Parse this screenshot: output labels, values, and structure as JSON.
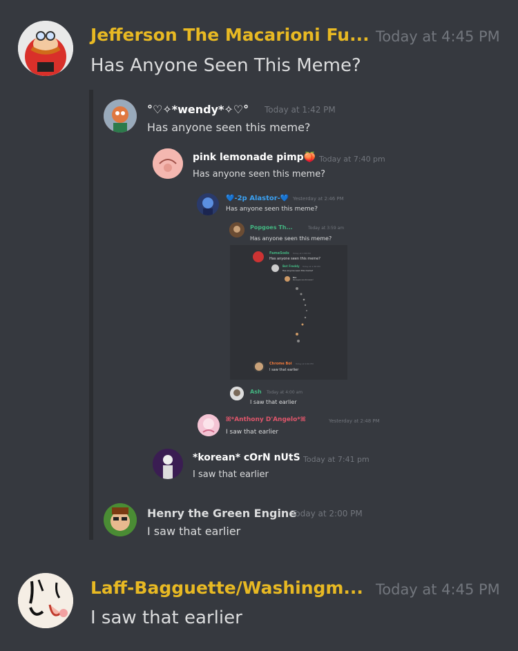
{
  "colors": {
    "background": "#36393f",
    "name_top": "#e8b923",
    "timestamp": "#72767d",
    "text": "#dcddde"
  },
  "top_message": {
    "author": "Jefferson The Macarioni Fu...",
    "timestamp": "Today at 4:45 PM",
    "text": "Has Anyone Seen This Meme?",
    "avatar_icon": "eggman-avatar"
  },
  "nested": [
    {
      "author": "°♡✧*wendy*✧♡°",
      "timestamp": "Today at 1:42 PM",
      "text": "Has anyone seen this meme?",
      "name_color": "#ffffff"
    },
    {
      "author": "pink lemonade pimp🍑",
      "timestamp": "Today at 7:40 pm",
      "text": "Has anyone seen this meme?",
      "name_color": "#ffffff"
    },
    {
      "author": "💙-2p Alastor-💙",
      "timestamp": "Yesterday at 2:46 PM",
      "text": "Has anyone seen this meme?",
      "name_color": "#3ba1f2"
    },
    {
      "author": "Popgoes Th...",
      "timestamp": "Today at 3:59 am",
      "text": "Has anyone seen this meme?",
      "name_color": "#43b581"
    },
    {
      "author": "FameSods",
      "timestamp": "Today at 1:58 PM",
      "text": "Has anyone seen this meme?",
      "name_color": "#43b581"
    },
    {
      "author": "Bot Freddy",
      "timestamp": "Today at 1:58 PM",
      "text": "Has anyone seen this meme?",
      "name_color": "#43b581"
    },
    {
      "author": "fox",
      "timestamp": "",
      "text": "Has anyone seen this meme?",
      "name_color": "#dcddde"
    },
    {
      "author": "Chrome Boi",
      "timestamp": "Today at 9:40 PM",
      "text": "I saw that earlier",
      "name_color": "#f47b3b"
    },
    {
      "author": "Ash",
      "timestamp": "Today at 4:00 am",
      "text": "I saw that earlier",
      "name_color": "#43b581"
    },
    {
      "author": "ꕤ*Anthony D'Angelo*ꕤ",
      "timestamp": "Yesterday at 2:48 PM",
      "text": "I saw that earlier",
      "name_color": "#e0566b"
    },
    {
      "author": "*korean* cOrN nUtS",
      "timestamp": "Today at 7:41 pm",
      "text": "I saw that earlier",
      "name_color": "#ffffff"
    },
    {
      "author": "Henry the Green Engine",
      "timestamp": "Today at 2:00 PM",
      "text": "I saw that earlier",
      "name_color": "#dcddde"
    }
  ],
  "bottom_message": {
    "author": "Laff-Bagguette/Washingm...",
    "timestamp": "Today at 4:45 PM",
    "text": "I saw that earlier",
    "avatar_icon": "cartoon-face-avatar"
  }
}
